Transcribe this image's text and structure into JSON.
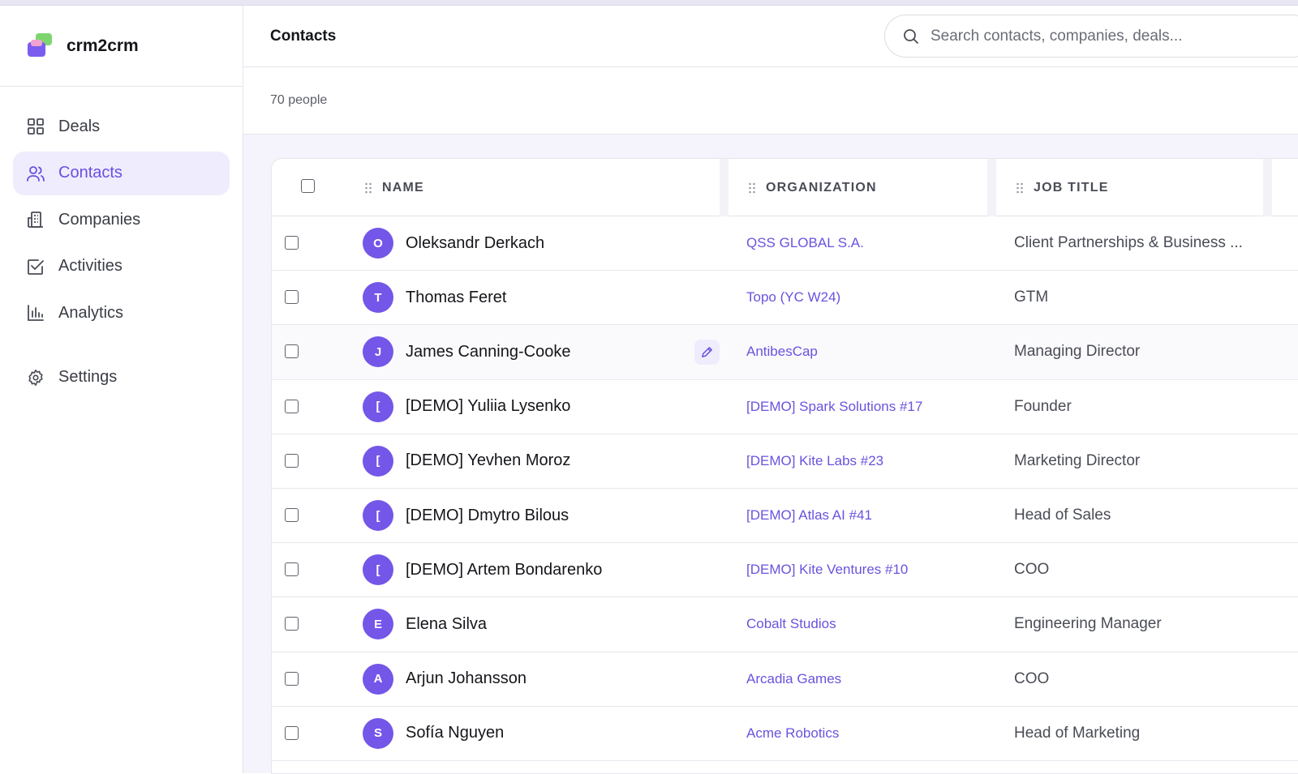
{
  "app": {
    "name": "crm2crm"
  },
  "sidebar": {
    "items": [
      {
        "label": "Deals",
        "icon": "grid-icon"
      },
      {
        "label": "Contacts",
        "icon": "users-icon",
        "active": true
      },
      {
        "label": "Companies",
        "icon": "building-icon"
      },
      {
        "label": "Activities",
        "icon": "checkbox-icon"
      },
      {
        "label": "Analytics",
        "icon": "bar-chart-icon"
      }
    ],
    "settings": {
      "label": "Settings",
      "icon": "gear-icon"
    }
  },
  "header": {
    "title": "Contacts",
    "search_placeholder": "Search contacts, companies, deals..."
  },
  "summary": {
    "count_label": "70 people"
  },
  "table": {
    "columns": {
      "name": "NAME",
      "organization": "ORGANIZATION",
      "job_title": "JOB TITLE"
    },
    "rows": [
      {
        "initial": "O",
        "name": "Oleksandr Derkach",
        "organization": "QSS GLOBAL S.A.",
        "job_title": "Client Partnerships & Business ..."
      },
      {
        "initial": "T",
        "name": "Thomas Feret",
        "organization": "Topo (YC W24)",
        "job_title": "GTM"
      },
      {
        "initial": "J",
        "name": "James Canning-Cooke",
        "organization": "AntibesCap",
        "job_title": "Managing Director"
      },
      {
        "initial": "[",
        "name": "[DEMO] Yuliia Lysenko",
        "organization": "[DEMO] Spark Solutions #17",
        "job_title": "Founder"
      },
      {
        "initial": "[",
        "name": "[DEMO] Yevhen Moroz",
        "organization": "[DEMO] Kite Labs #23",
        "job_title": "Marketing Director"
      },
      {
        "initial": "[",
        "name": "[DEMO] Dmytro Bilous",
        "organization": "[DEMO] Atlas AI #41",
        "job_title": "Head of Sales"
      },
      {
        "initial": "[",
        "name": "[DEMO] Artem Bondarenko",
        "organization": "[DEMO] Kite Ventures #10",
        "job_title": "COO"
      },
      {
        "initial": "E",
        "name": "Elena Silva",
        "organization": "Cobalt Studios",
        "job_title": "Engineering Manager"
      },
      {
        "initial": "A",
        "name": "Arjun Johansson",
        "organization": "Arcadia Games",
        "job_title": "COO"
      },
      {
        "initial": "S",
        "name": "Sofía Nguyen",
        "organization": "Acme Robotics",
        "job_title": "Head of Marketing"
      }
    ]
  },
  "colors": {
    "accent": "#6a4fe0",
    "avatar": "#7456e8",
    "active_bg": "#efecfd"
  }
}
